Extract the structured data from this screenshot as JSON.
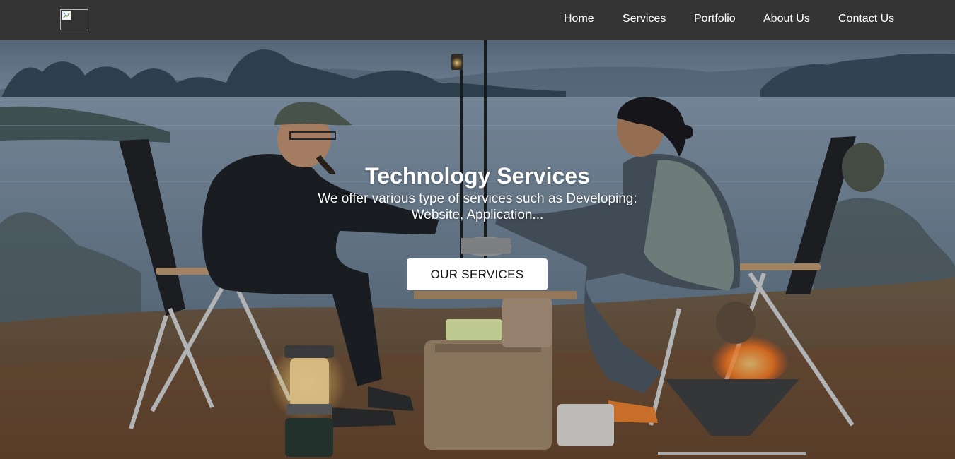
{
  "nav": {
    "logo_alt": "",
    "items": [
      {
        "label": "Home"
      },
      {
        "label": "Services"
      },
      {
        "label": "Portfolio"
      },
      {
        "label": "About Us"
      },
      {
        "label": "Contact Us"
      }
    ]
  },
  "hero": {
    "title": "Technology Services",
    "subtitle": "We offer various type of services such as Developing: Website, Application...",
    "cta_label": "OUR SERVICES",
    "background_image": "camping-photo"
  },
  "colors": {
    "header_bg": "#333333",
    "nav_text": "#ffffff",
    "button_bg": "#ffffff",
    "button_text": "#111111"
  }
}
